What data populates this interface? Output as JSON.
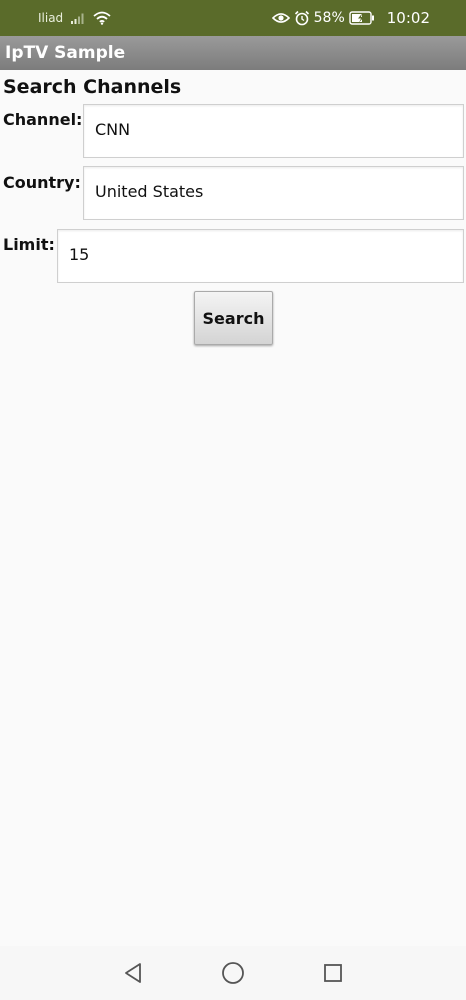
{
  "status_bar": {
    "carrier": "Iliad",
    "battery": "58%",
    "time": "10:02",
    "icons": [
      "signal-icon",
      "wifi-icon",
      "eye-icon",
      "alarm-icon",
      "battery-charging-icon"
    ]
  },
  "app": {
    "title": "IpTV Sample"
  },
  "form": {
    "title": "Search Channels",
    "channel_label": "Channel:",
    "channel_value": "CNN",
    "country_label": "Country:",
    "country_value": "United States",
    "limit_label": "Limit:",
    "limit_value": "15",
    "search_label": "Search"
  },
  "nav": {
    "icons": [
      "back-icon",
      "home-icon",
      "recents-icon"
    ]
  },
  "colors": {
    "status_bar": "#5a6b2a",
    "title_bar": "#8a8a8a",
    "background": "#fafafa"
  }
}
